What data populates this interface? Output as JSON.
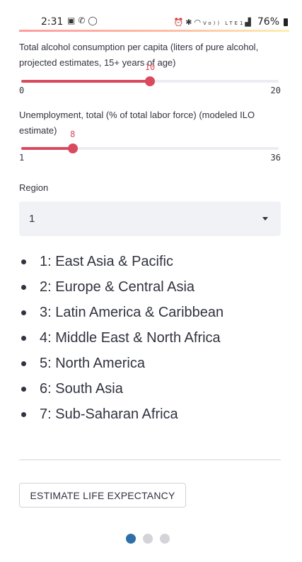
{
  "status_bar": {
    "time": "2:31",
    "left_icons": [
      "image-icon",
      "phone-icon",
      "circle-icon"
    ],
    "right_icons": [
      "alarm-icon",
      "bluetooth-icon",
      "wifi-icon",
      "volte-icon",
      "signal-icon"
    ],
    "volte_text": "Vo)) LTE1",
    "battery": "76%"
  },
  "alcohol_slider": {
    "label": "Total alcohol consumption per capita (liters of pure alcohol, projected estimates, 15+ years of age)",
    "value": "10",
    "min": "0",
    "max": "20"
  },
  "unemployment_slider": {
    "label": "Unemployment, total (% of total labor force) (modeled ILO estimate)",
    "value": "8",
    "min": "1",
    "max": "36"
  },
  "region": {
    "label": "Region",
    "selected": "1",
    "list": [
      "1: East Asia & Pacific",
      "2: Europe & Central Asia",
      "3: Latin America & Caribbean",
      "4: Middle East & North Africa",
      "5: North America",
      "6: South Asia",
      "7: Sub-Saharan Africa"
    ]
  },
  "estimate_button": {
    "label": "ESTIMATE LIFE EXPECTANCY"
  },
  "page_indicator": {
    "count": 3,
    "active": 1
  },
  "colors": {
    "accent": "#d94a5f",
    "dot_active": "#2f6fa8",
    "dot_inactive": "#d4d4d8",
    "select_bg": "#f0f2f6"
  }
}
